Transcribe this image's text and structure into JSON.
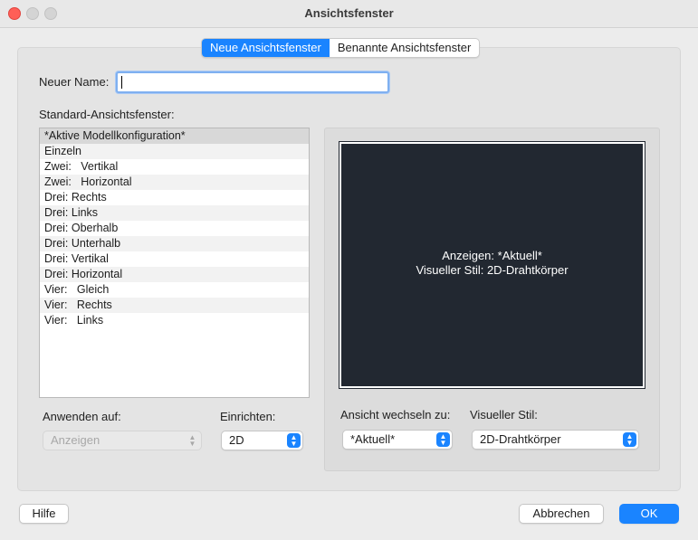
{
  "window": {
    "title": "Ansichtsfenster"
  },
  "tabs": [
    {
      "label": "Neue Ansichtsfenster",
      "active": true
    },
    {
      "label": "Benannte Ansichtsfenster",
      "active": false
    }
  ],
  "name_field": {
    "label": "Neuer Name:",
    "value": ""
  },
  "standard_list": {
    "label": "Standard-Ansichtsfenster:",
    "items": [
      "*Aktive Modellkonfiguration*",
      "Einzeln",
      "Zwei:   Vertikal",
      "Zwei:   Horizontal",
      "Drei: Rechts",
      "Drei: Links",
      "Drei: Oberhalb",
      "Drei: Unterhalb",
      "Drei: Vertikal",
      "Drei: Horizontal",
      "Vier:   Gleich",
      "Vier:   Rechts",
      "Vier:   Links"
    ],
    "selected_index": 0
  },
  "preview": {
    "line1": "Anzeigen: *Aktuell*",
    "line2": "Visueller Stil: 2D-Drahtkörper"
  },
  "apply_to": {
    "label": "Anwenden auf:",
    "value": "Anzeigen",
    "disabled": true
  },
  "setup": {
    "label": "Einrichten:",
    "value": "2D"
  },
  "change_view": {
    "label": "Ansicht wechseln zu:",
    "value": "*Aktuell*"
  },
  "visual_style": {
    "label": "Visueller Stil:",
    "value": "2D-Drahtkörper"
  },
  "buttons": {
    "help": "Hilfe",
    "cancel": "Abbrechen",
    "ok": "OK"
  },
  "colors": {
    "accent": "#1a84ff",
    "preview_bg": "#222831",
    "close": "#ff5f57"
  }
}
